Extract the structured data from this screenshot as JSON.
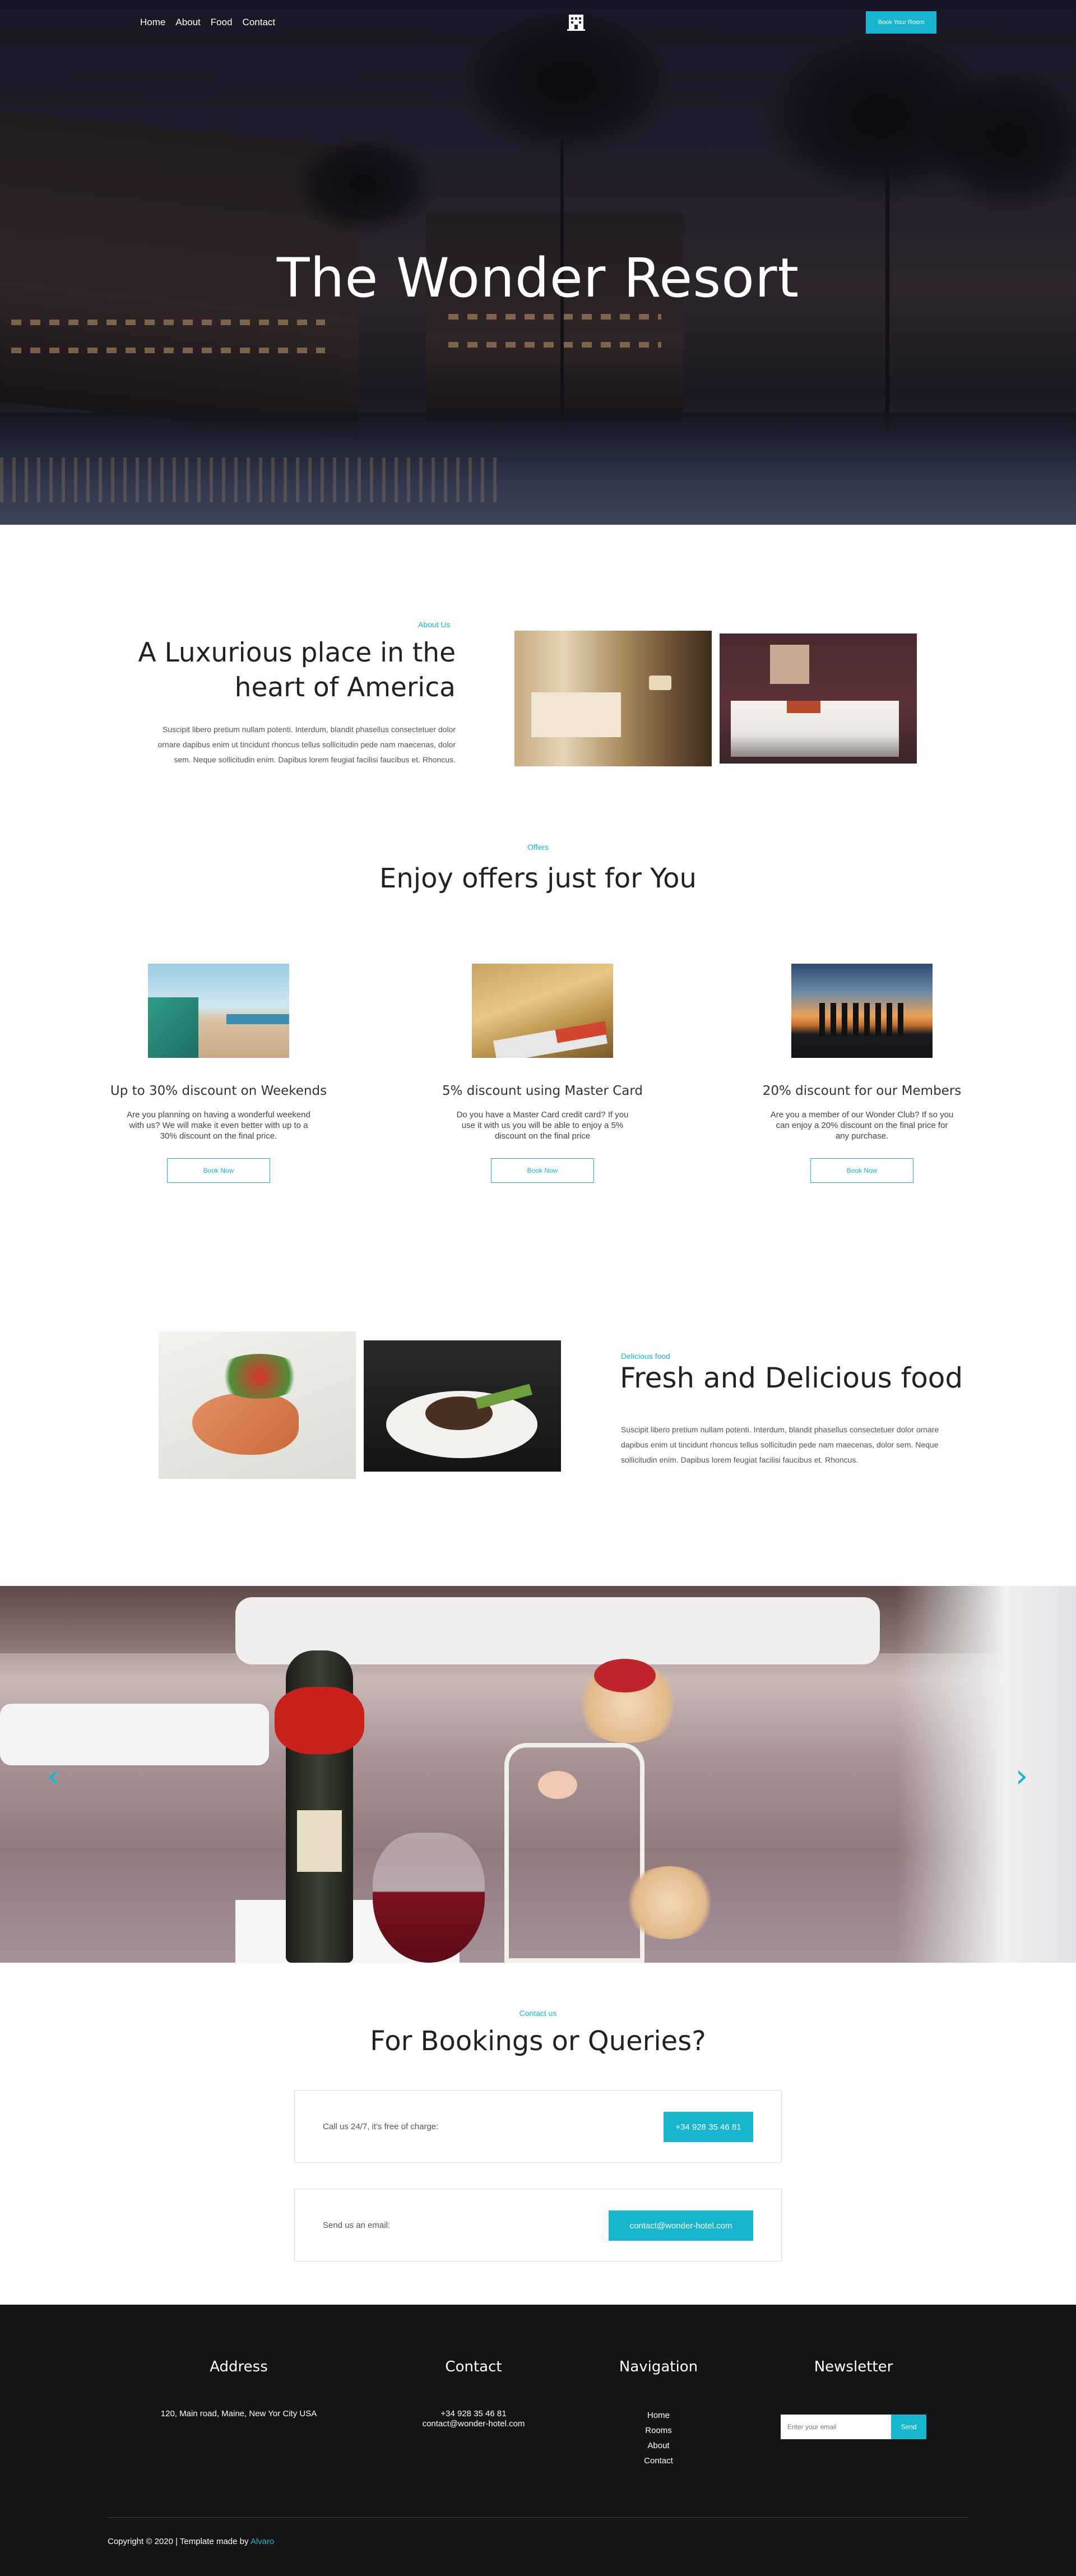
{
  "nav": {
    "links": [
      "Home",
      "About",
      "Food",
      "Contact"
    ],
    "logo_icon": "hotel-building-icon",
    "book_button": "Book Your Room"
  },
  "hero": {
    "title": "The Wonder Resort"
  },
  "about": {
    "eyebrow": "About Us",
    "title": "A Luxurious place in the heart of America",
    "text": "Suscipit libero pretium nullam potenti. Interdum, blandit phasellus consectetuer dolor ornare dapibus enim ut tincidunt rhoncus tellus sollicitudin pede nam maecenas, dolor sem. Neque sollicitudin enim. Dapibus lorem feugiat facilisi faucibus et. Rhoncus."
  },
  "offers": {
    "eyebrow": "Offers",
    "title": "Enjoy offers just for You",
    "items": [
      {
        "title": "Up to 30% discount on Weekends",
        "text": "Are you planning on having a wonderful weekend with us? We will make it even better with up to a 30% discount on the final price.",
        "button": "Book Now"
      },
      {
        "title": "5% discount using Master Card",
        "text": "Do you have a Master Card credit card? If you use it with us you will be able to enjoy a 5% discount on the final price",
        "button": "Book Now"
      },
      {
        "title": "20% discount for our Members",
        "text": "Are you a member of our Wonder Club? If so you can enjoy a 20% discount on the final price for any purchase.",
        "button": "Book Now"
      }
    ]
  },
  "food": {
    "eyebrow": "Delicious food",
    "title": "Fresh and Delicious food",
    "text": "Suscipit libero pretium nullam potenti. Interdum, blandit phasellus consectetuer dolor ornare dapibus enim ut tincidunt rhoncus tellus sollicitudin pede nam maecenas, dolor sem. Neque sollicitudin enim. Dapibus lorem feugiat facilisi faucibus et. Rhoncus."
  },
  "slider": {
    "prev_icon": "chevron-left-icon",
    "next_icon": "chevron-right-icon"
  },
  "contact": {
    "eyebrow": "Contact us",
    "title": "For Bookings or Queries?",
    "phone_label": "Call us 24/7, it's free of charge:",
    "phone": "+34 928 35 46 81",
    "email_label": "Send us an email:",
    "email": "contact@wonder-hotel.com"
  },
  "footer": {
    "address_title": "Address",
    "address": "120, Main road, Maine, New Yor City USA",
    "contact_title": "Contact",
    "contact_phone": "+34 928 35 46 81",
    "contact_email": "contact@wonder-hotel.com",
    "nav_title": "Navigation",
    "nav_links": [
      "Home",
      "Rooms",
      "About",
      "Contact"
    ],
    "newsletter_title": "Newsletter",
    "newsletter_placeholder": "Enter your email",
    "newsletter_button": "Send",
    "copyright": "Copyright © 2020 | Template made by ",
    "author": "Alvaro"
  },
  "colors": {
    "accent": "#17b6cf",
    "footer_bg": "#141414"
  }
}
